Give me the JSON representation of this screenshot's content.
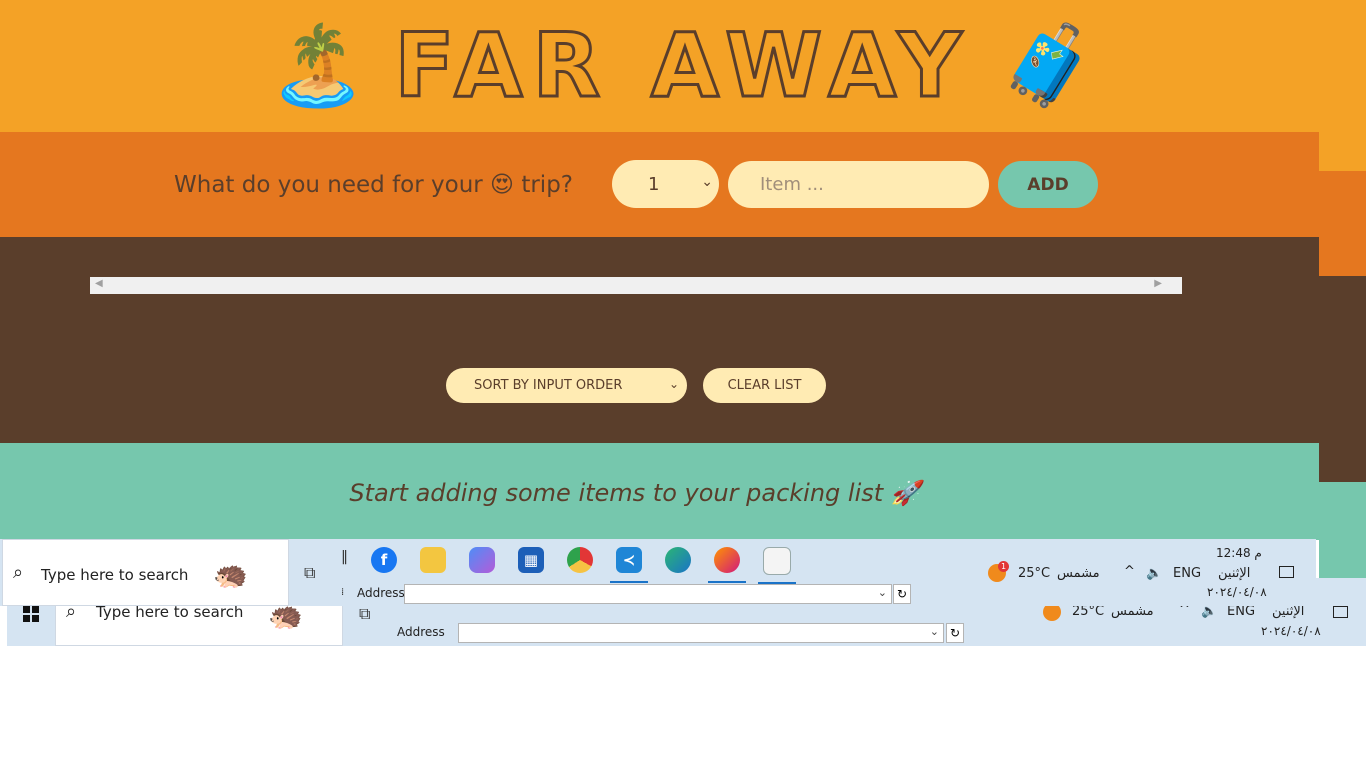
{
  "header": {
    "left_icon": "palm-tree-island-icon",
    "title": "FAR AWAY",
    "right_icon": "luggage-icon"
  },
  "form": {
    "question": "What do you need for your 😍 trip?",
    "quantity_value": "1",
    "item_placeholder": "Item ...",
    "add_label": "ADD"
  },
  "list": {
    "sort_value": "SORT BY INPUT ORDER",
    "clear_label": "CLEAR LIST"
  },
  "stats": {
    "message": "Start adding some items to your packing list 🚀"
  },
  "taskbar": {
    "search_placeholder": "Type here to search",
    "address_label": "Address",
    "address_value": "",
    "weather_temp": "25°C",
    "weather_text": "مشمس",
    "weather_badge": "1",
    "language": "ENG",
    "time": "12:48 م",
    "day": "الإثنين",
    "date": "٢٠٢٤/٠٤/٠٨",
    "apps": [
      "facebook-icon",
      "file-explorer-icon",
      "copilot-icon",
      "microsoft-store-icon",
      "chrome-icon",
      "vscode-icon",
      "edge-icon",
      "firefox-icon",
      "notepad-icon"
    ]
  },
  "colors": {
    "header": "#f4a226",
    "form": "#e5771f",
    "list": "#5a3e2b",
    "stats": "#76c7ad",
    "pill": "#ffebb3",
    "text": "#5a3e2b",
    "taskbar": "#d5e4f2"
  }
}
